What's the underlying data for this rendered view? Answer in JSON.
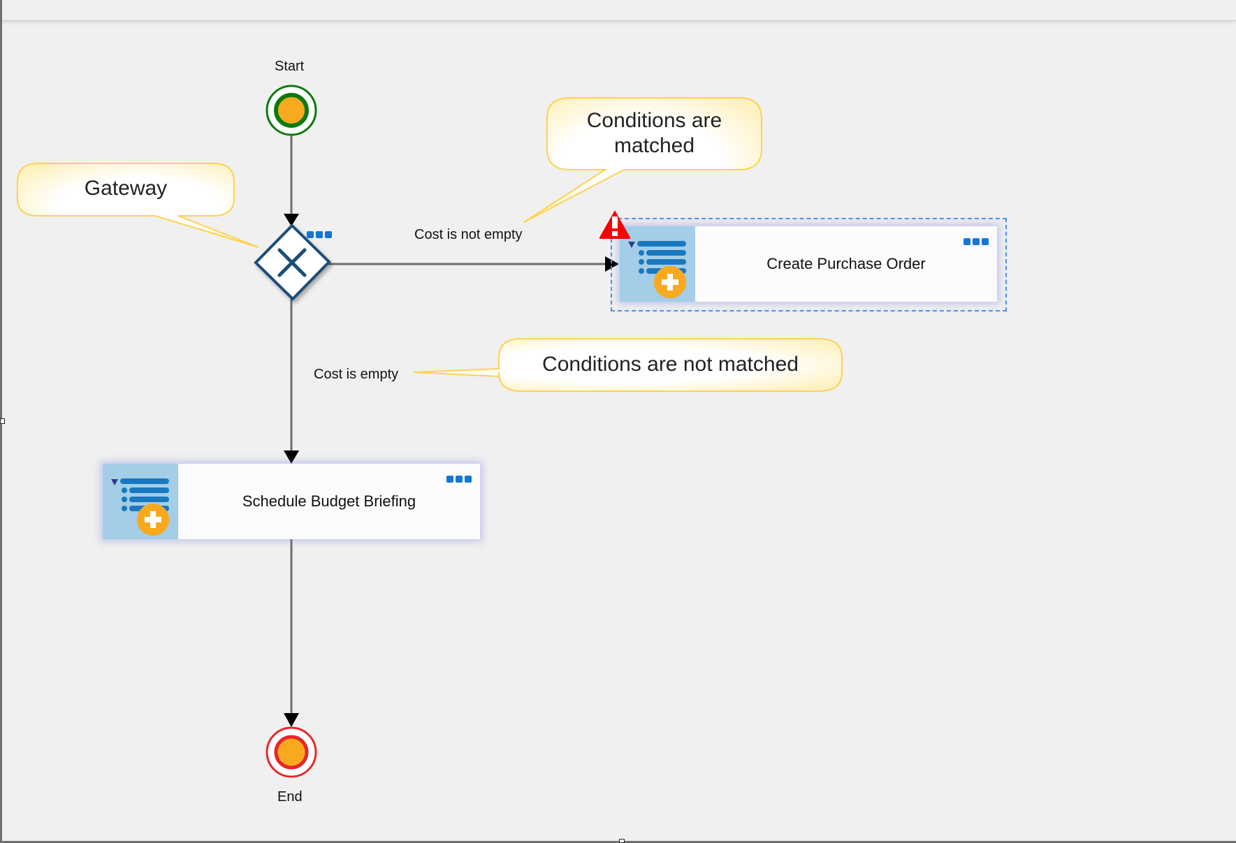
{
  "diagram": {
    "type": "BPMN process",
    "nodes": {
      "start": {
        "label": "Start",
        "kind": "start-event",
        "color": "#0a7a0a"
      },
      "gateway": {
        "label": "",
        "kind": "exclusive-gateway",
        "color": "#1f4e79"
      },
      "task_create_po": {
        "label": "Create Purchase Order",
        "kind": "user-task",
        "selected": true,
        "warning": true
      },
      "task_schedule": {
        "label": "Schedule Budget Briefing",
        "kind": "user-task",
        "selected": false,
        "warning": false
      },
      "end": {
        "label": "End",
        "kind": "end-event",
        "color": "#e8262b"
      }
    },
    "edges": {
      "start_to_gateway": {
        "label": ""
      },
      "gateway_to_create_po": {
        "label": "Cost is not empty"
      },
      "gateway_to_schedule": {
        "label": "Cost is empty"
      },
      "schedule_to_end": {
        "label": ""
      }
    },
    "callouts": {
      "gateway": {
        "text": "Gateway"
      },
      "matched": {
        "line1": "Conditions are",
        "line2": "matched"
      },
      "not_matched": {
        "text": "Conditions are not matched"
      }
    },
    "colors": {
      "canvas": "#eff0ef",
      "connector": "#6e6e6e",
      "callout_border": "#ffd24d",
      "task_panel": "#a4cde7",
      "selection": "#4f8ef0",
      "more_dots": "#1576d1",
      "event_fill": "#f9a91e"
    }
  }
}
